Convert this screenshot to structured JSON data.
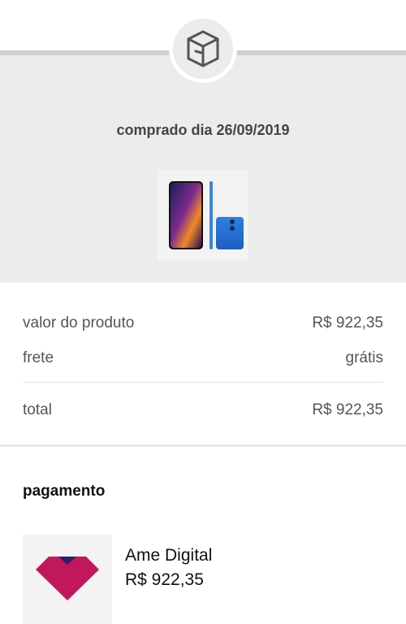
{
  "header": {
    "badge_icon": "box-icon",
    "purchase_date": "comprado dia 26/09/2019"
  },
  "product": {
    "image": "smartphone-image"
  },
  "summary": {
    "rows": [
      {
        "label": "valor do produto",
        "value": "R$ 922,35"
      },
      {
        "label": "frete",
        "value": "grátis"
      }
    ],
    "total_label": "total",
    "total_value": "R$ 922,35"
  },
  "payment": {
    "title": "pagamento",
    "method": "Ame Digital",
    "amount": "R$ 922,35",
    "logo_icon": "ame-logo-icon",
    "logo_color": "#c2185b"
  }
}
